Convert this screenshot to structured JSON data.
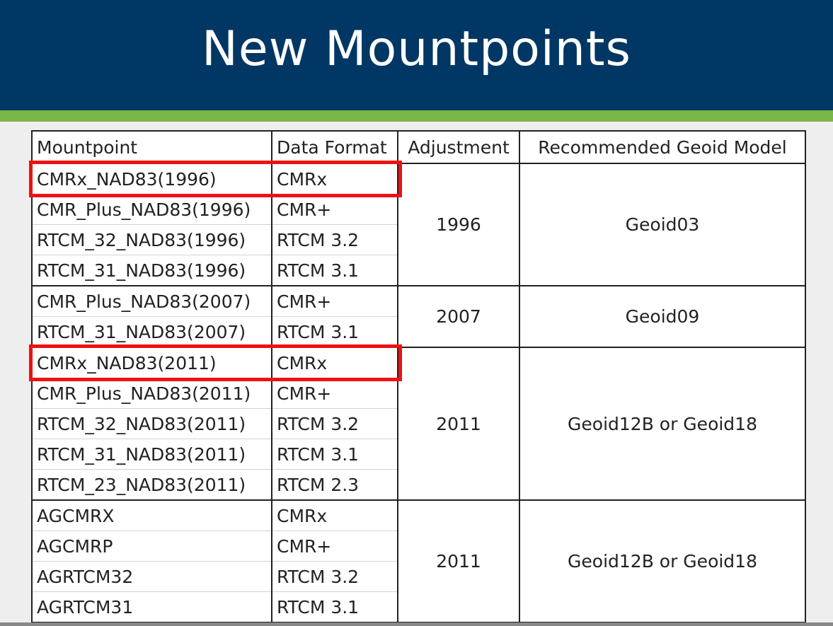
{
  "slide": {
    "title": "New Mountpoints",
    "colors": {
      "header_bg": "#003764",
      "accent": "#7ab648",
      "highlight": "#ee1111"
    }
  },
  "table": {
    "headers": [
      "Mountpoint",
      "Data Format",
      "Adjustment",
      "Recommended Geoid Model"
    ],
    "groups": [
      {
        "adjustment": "1996",
        "geoid": "Geoid03",
        "rows": [
          {
            "mountpoint": "CMRx_NAD83(1996)",
            "format": "CMRx",
            "highlighted": true
          },
          {
            "mountpoint": "CMR_Plus_NAD83(1996)",
            "format": "CMR+"
          },
          {
            "mountpoint": "RTCM_32_NAD83(1996)",
            "format": "RTCM 3.2"
          },
          {
            "mountpoint": "RTCM_31_NAD83(1996)",
            "format": "RTCM 3.1"
          }
        ]
      },
      {
        "adjustment": "2007",
        "geoid": "Geoid09",
        "rows": [
          {
            "mountpoint": "CMR_Plus_NAD83(2007)",
            "format": "CMR+"
          },
          {
            "mountpoint": "RTCM_31_NAD83(2007)",
            "format": "RTCM 3.1"
          }
        ]
      },
      {
        "adjustment": "2011",
        "geoid": "Geoid12B or Geoid18",
        "rows": [
          {
            "mountpoint": "CMRx_NAD83(2011)",
            "format": "CMRx",
            "highlighted": true
          },
          {
            "mountpoint": "CMR_Plus_NAD83(2011)",
            "format": "CMR+"
          },
          {
            "mountpoint": "RTCM_32_NAD83(2011)",
            "format": "RTCM 3.2"
          },
          {
            "mountpoint": "RTCM_31_NAD83(2011)",
            "format": "RTCM 3.1"
          },
          {
            "mountpoint": "RTCM_23_NAD83(2011)",
            "format": "RTCM 2.3"
          }
        ]
      },
      {
        "adjustment": "2011",
        "geoid": "Geoid12B or Geoid18",
        "rows": [
          {
            "mountpoint": "AGCMRX",
            "format": "CMRx"
          },
          {
            "mountpoint": "AGCMRP",
            "format": "CMR+"
          },
          {
            "mountpoint": "AGRTCM32",
            "format": "RTCM 3.2"
          },
          {
            "mountpoint": "AGRTCM31",
            "format": "RTCM 3.1"
          }
        ]
      }
    ]
  }
}
